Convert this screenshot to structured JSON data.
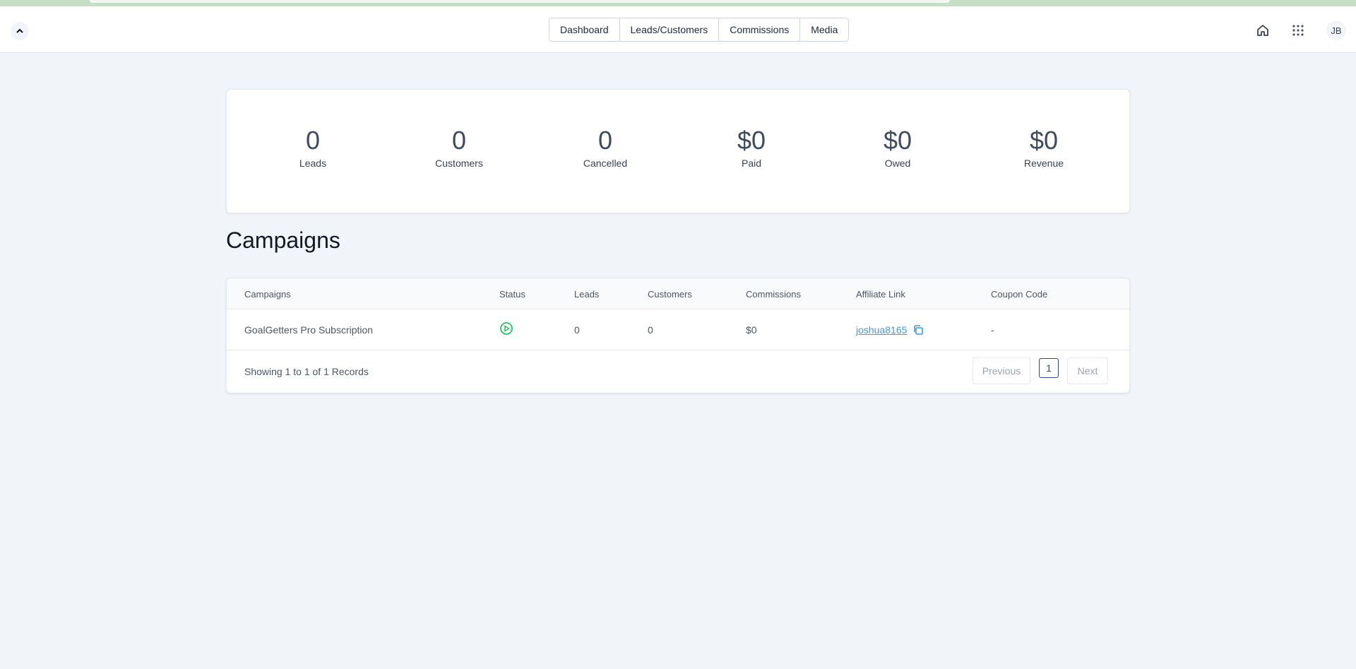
{
  "nav": {
    "items": [
      "Dashboard",
      "Leads/Customers",
      "Commissions",
      "Media"
    ]
  },
  "user": {
    "initials": "JB"
  },
  "stats": [
    {
      "value": "0",
      "label": "Leads"
    },
    {
      "value": "0",
      "label": "Customers"
    },
    {
      "value": "0",
      "label": "Cancelled"
    },
    {
      "value": "$0",
      "label": "Paid"
    },
    {
      "value": "$0",
      "label": "Owed"
    },
    {
      "value": "$0",
      "label": "Revenue"
    }
  ],
  "campaigns": {
    "title": "Campaigns",
    "columns": [
      "Campaigns",
      "Status",
      "Leads",
      "Customers",
      "Commissions",
      "Affiliate Link",
      "Coupon Code"
    ],
    "rows": [
      {
        "campaign": "GoalGetters Pro Subscription",
        "status": "play-circle-icon",
        "leads": "0",
        "customers": "0",
        "commissions": "$0",
        "affiliate_link": "joshua8165",
        "coupon_code": "-"
      }
    ],
    "footer": "Showing 1 to 1 of 1 Records",
    "pager": {
      "previous": "Previous",
      "page": "1",
      "next": "Next"
    }
  },
  "colors": {
    "status_active": "#22c55e",
    "link": "#3b9bd8",
    "page_active": "#2f4a8a"
  }
}
